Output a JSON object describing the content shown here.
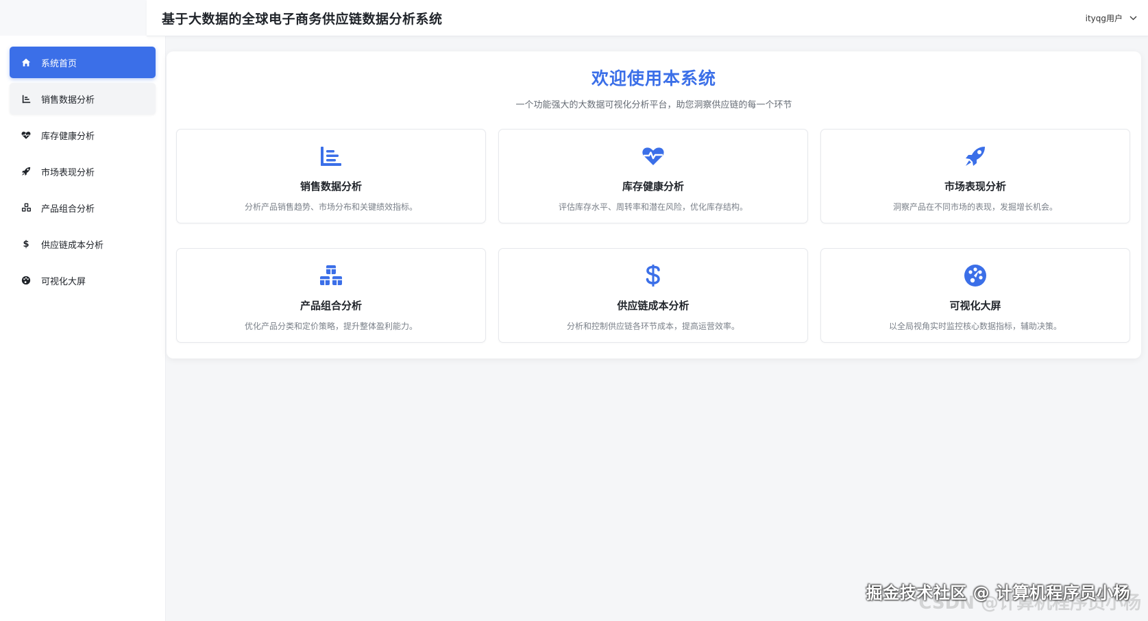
{
  "header": {
    "title": "基于大数据的全球电子商务供应链数据分析系统",
    "user_label": "ityqg用户"
  },
  "sidebar": {
    "items": [
      {
        "label": "系统首页",
        "icon": "home-icon",
        "active": true
      },
      {
        "label": "销售数据分析",
        "icon": "chart-bar-icon",
        "active": false
      },
      {
        "label": "库存健康分析",
        "icon": "heartbeat-icon",
        "active": false
      },
      {
        "label": "市场表现分析",
        "icon": "rocket-icon",
        "active": false
      },
      {
        "label": "产品组合分析",
        "icon": "cubes-icon",
        "active": false
      },
      {
        "label": "供应链成本分析",
        "icon": "dollar-icon",
        "active": false
      },
      {
        "label": "可视化大屏",
        "icon": "palette-icon",
        "active": false
      }
    ]
  },
  "main": {
    "welcome_title": "欢迎使用本系统",
    "welcome_subtitle": "一个功能强大的大数据可视化分析平台，助您洞察供应链的每一个环节",
    "cards": [
      {
        "title": "销售数据分析",
        "desc": "分析产品销售趋势、市场分布和关键绩效指标。",
        "icon": "chart-bar-icon"
      },
      {
        "title": "库存健康分析",
        "desc": "评估库存水平、周转率和潜在风险，优化库存结构。",
        "icon": "heartbeat-icon"
      },
      {
        "title": "市场表现分析",
        "desc": "洞察产品在不同市场的表现，发掘增长机会。",
        "icon": "rocket-icon"
      },
      {
        "title": "产品组合分析",
        "desc": "优化产品分类和定价策略，提升整体盈利能力。",
        "icon": "cubes-icon"
      },
      {
        "title": "供应链成本分析",
        "desc": "分析和控制供应链各环节成本，提高运营效率。",
        "icon": "dollar-icon"
      },
      {
        "title": "可视化大屏",
        "desc": "以全局视角实时监控核心数据指标，辅助决策。",
        "icon": "palette-icon"
      }
    ]
  },
  "watermark": {
    "text": "掘金技术社区 @ 计算机程序员小杨",
    "ghost_text": "CSDN @计算机程序员小杨"
  },
  "colors": {
    "accent": "#3b6fe8",
    "sidebar_bg": "#ffffff",
    "page_bg": "#f5f6f8"
  }
}
